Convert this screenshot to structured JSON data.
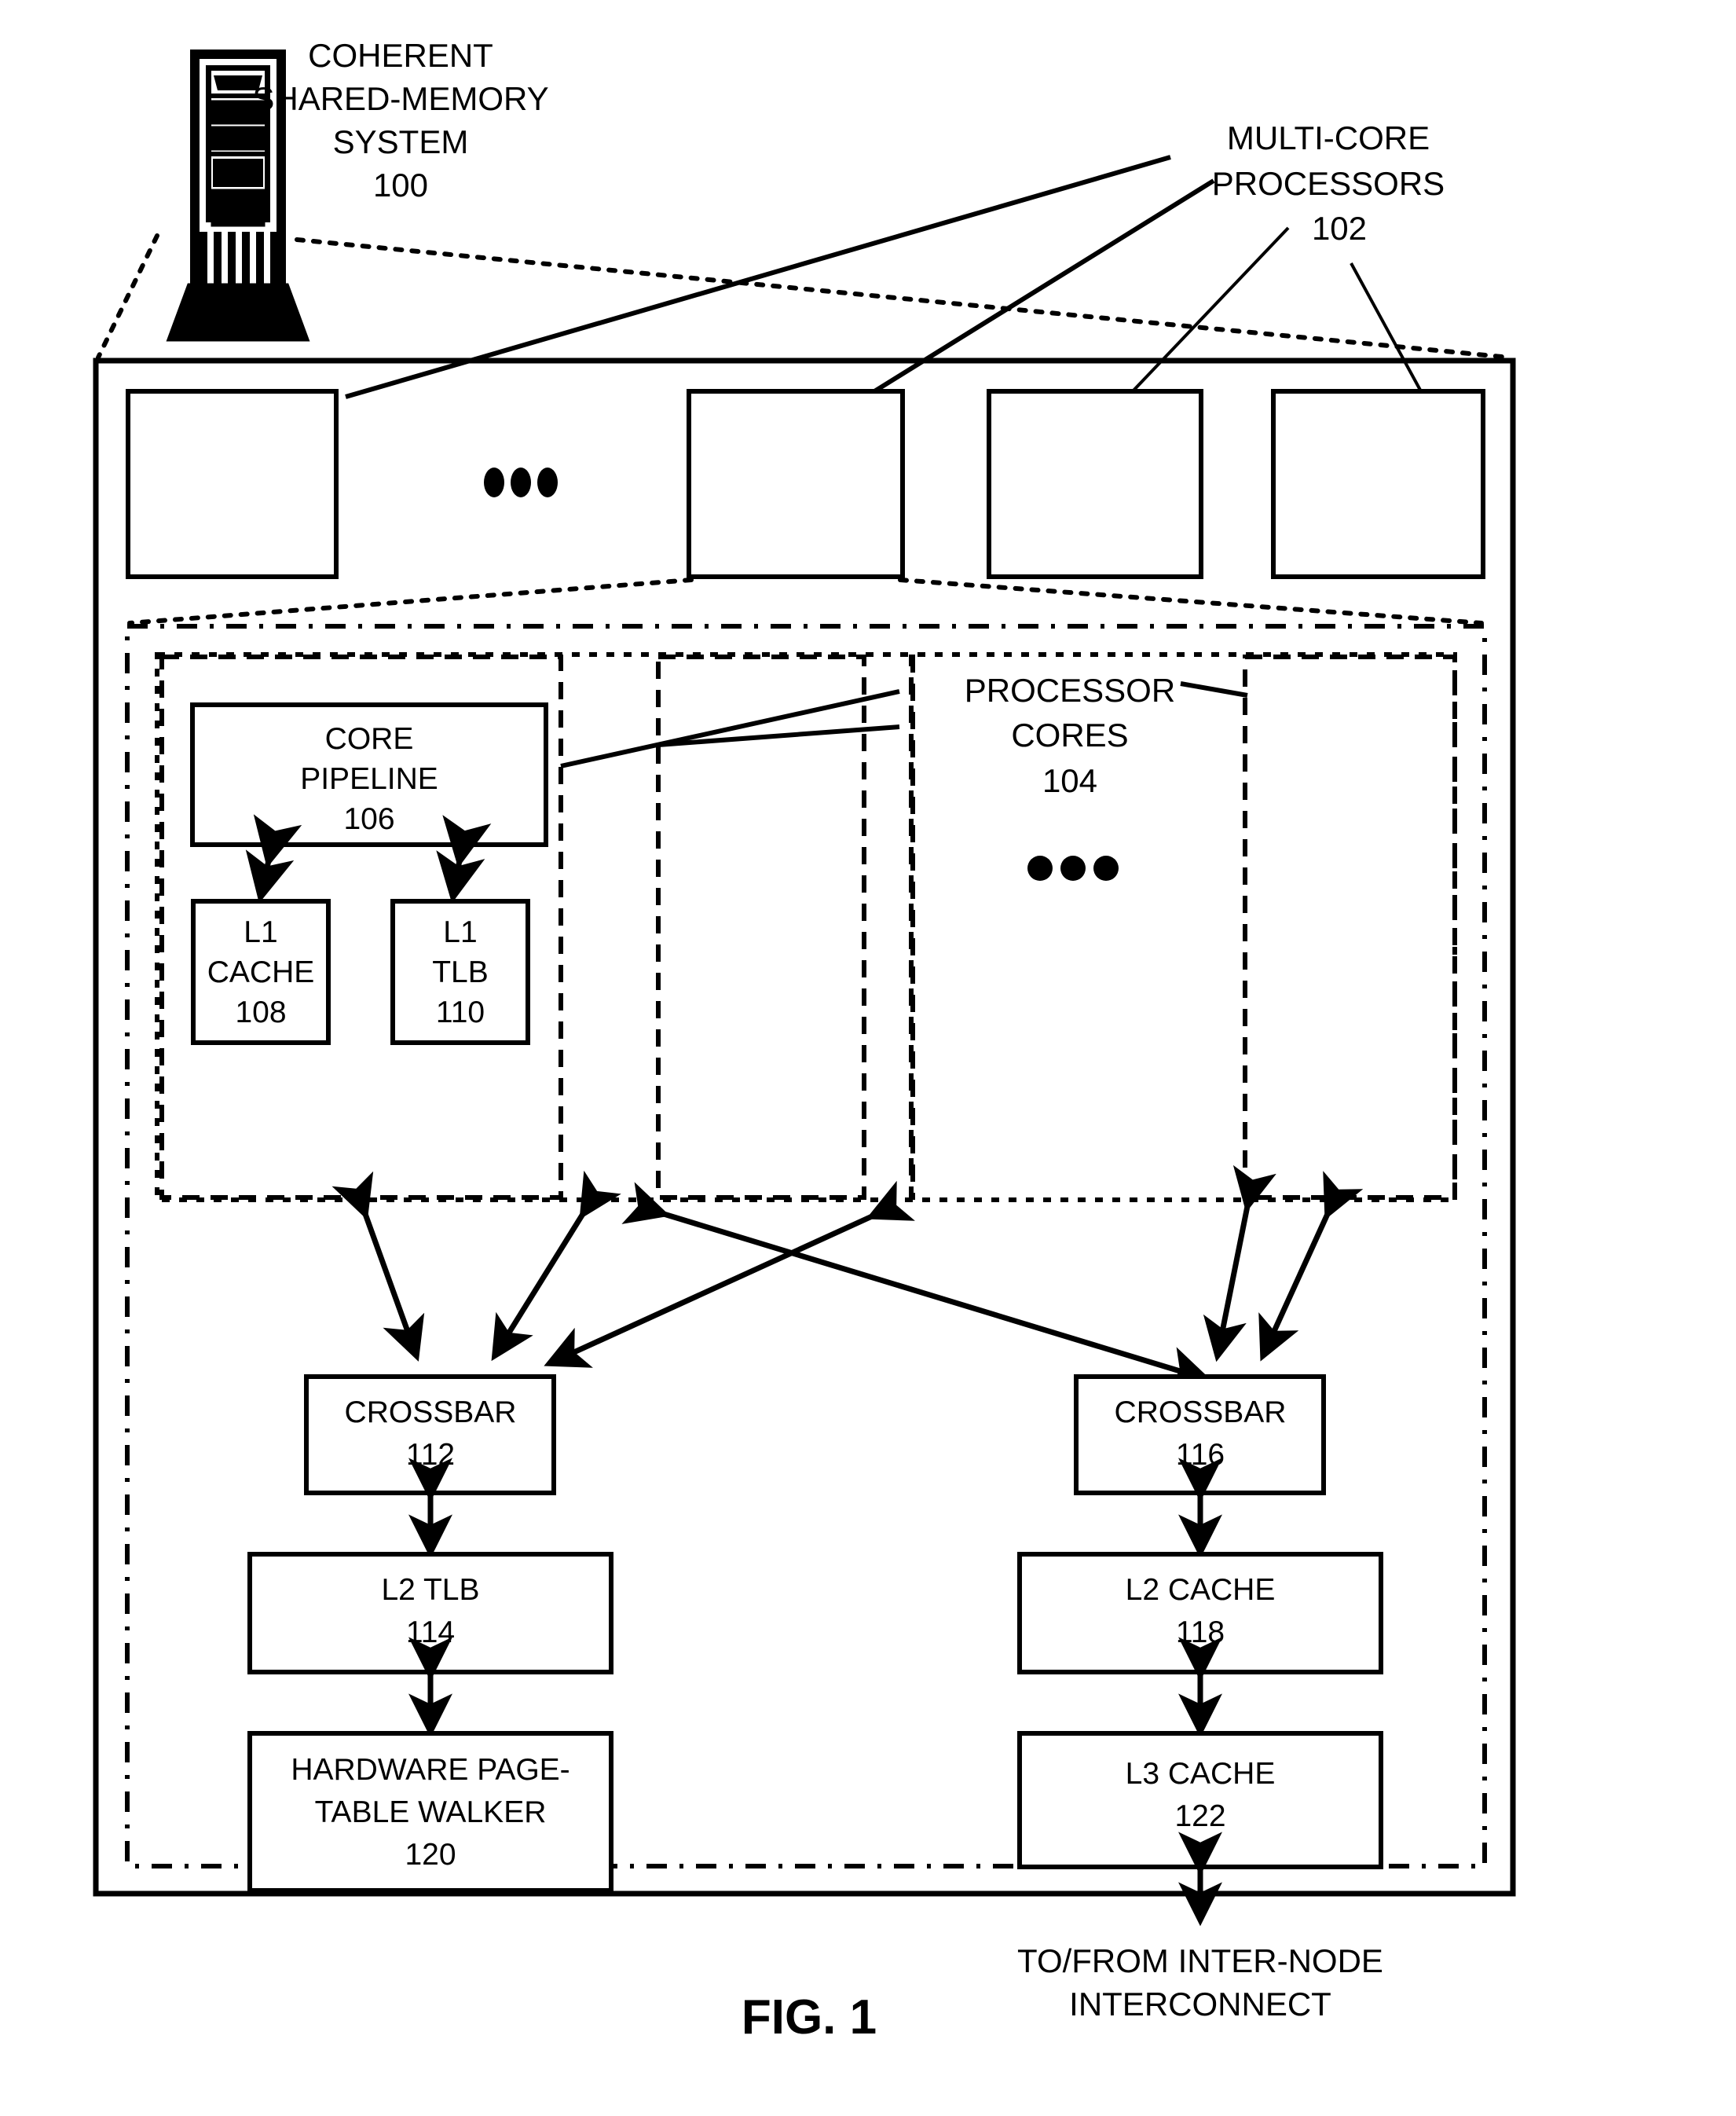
{
  "figure": {
    "caption": "FIG. 1"
  },
  "callouts": {
    "system": {
      "line1": "COHERENT",
      "line2": "SHARED-MEMORY",
      "line3": "SYSTEM",
      "ref": "100"
    },
    "processors": {
      "line1": "MULTI-CORE",
      "line2": "PROCESSORS",
      "ref": "102"
    },
    "cores": {
      "line1": "PROCESSOR",
      "line2": "CORES",
      "ref": "104"
    }
  },
  "icons": {
    "server_tower": "server-tower-icon",
    "ellipsis_processors": "ellipsis-icon",
    "ellipsis_cores": "ellipsis-icon"
  },
  "blocks": {
    "core_pipeline": {
      "line1": "CORE",
      "line2": "PIPELINE",
      "ref": "106"
    },
    "l1_cache": {
      "line1": "L1",
      "line2": "CACHE",
      "ref": "108"
    },
    "l1_tlb": {
      "line1": "L1",
      "line2": "TLB",
      "ref": "110"
    },
    "crossbar_left": {
      "line1": "CROSSBAR",
      "ref": "112"
    },
    "crossbar_right": {
      "line1": "CROSSBAR",
      "ref": "116"
    },
    "l2_tlb": {
      "line1": "L2 TLB",
      "ref": "114"
    },
    "l2_cache": {
      "line1": "L2 CACHE",
      "ref": "118"
    },
    "page_table_walker": {
      "line1": "HARDWARE PAGE-",
      "line2": "TABLE WALKER",
      "ref": "120"
    },
    "l3_cache": {
      "line1": "L3 CACHE",
      "ref": "122"
    }
  },
  "annotations": {
    "interconnect": {
      "line1": "TO/FROM INTER-NODE",
      "line2": "INTERCONNECT"
    }
  },
  "colors": {
    "stroke": "#000000",
    "background": "#ffffff"
  }
}
